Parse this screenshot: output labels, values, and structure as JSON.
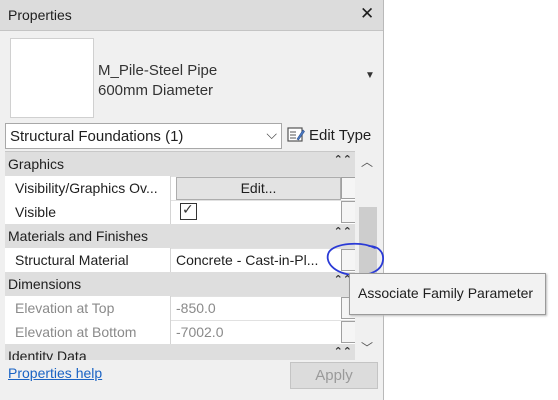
{
  "window": {
    "title": "Properties",
    "close_icon": "close-icon"
  },
  "type_selector": {
    "name_line1": "M_Pile-Steel Pipe",
    "name_line2": "600mm Diameter"
  },
  "category_filter": {
    "label": "Structural Foundations (1)"
  },
  "edit_type": {
    "label": "Edit Type",
    "icon": "edit-type-icon"
  },
  "groups": {
    "graphics": "Graphics",
    "materials": "Materials and Finishes",
    "dimensions": "Dimensions",
    "identity": "Identity Data"
  },
  "params": {
    "visibility": {
      "name": "Visibility/Graphics Ov...",
      "button": "Edit..."
    },
    "visible": {
      "name": "Visible",
      "checked": true,
      "check_glyph": "✓"
    },
    "material": {
      "name": "Structural Material",
      "value": "Concrete - Cast-in-Pl..."
    },
    "elev_top": {
      "name": "Elevation at Top",
      "value": "-850.0"
    },
    "elev_bottom": {
      "name": "Elevation at Bottom",
      "value": "-7002.0"
    }
  },
  "footer": {
    "help_link": "Properties help",
    "apply": "Apply"
  },
  "tooltip": {
    "text": "Associate Family Parameter"
  },
  "colors": {
    "annotation_circle": "#2a3ad6",
    "link": "#1a63c4"
  }
}
